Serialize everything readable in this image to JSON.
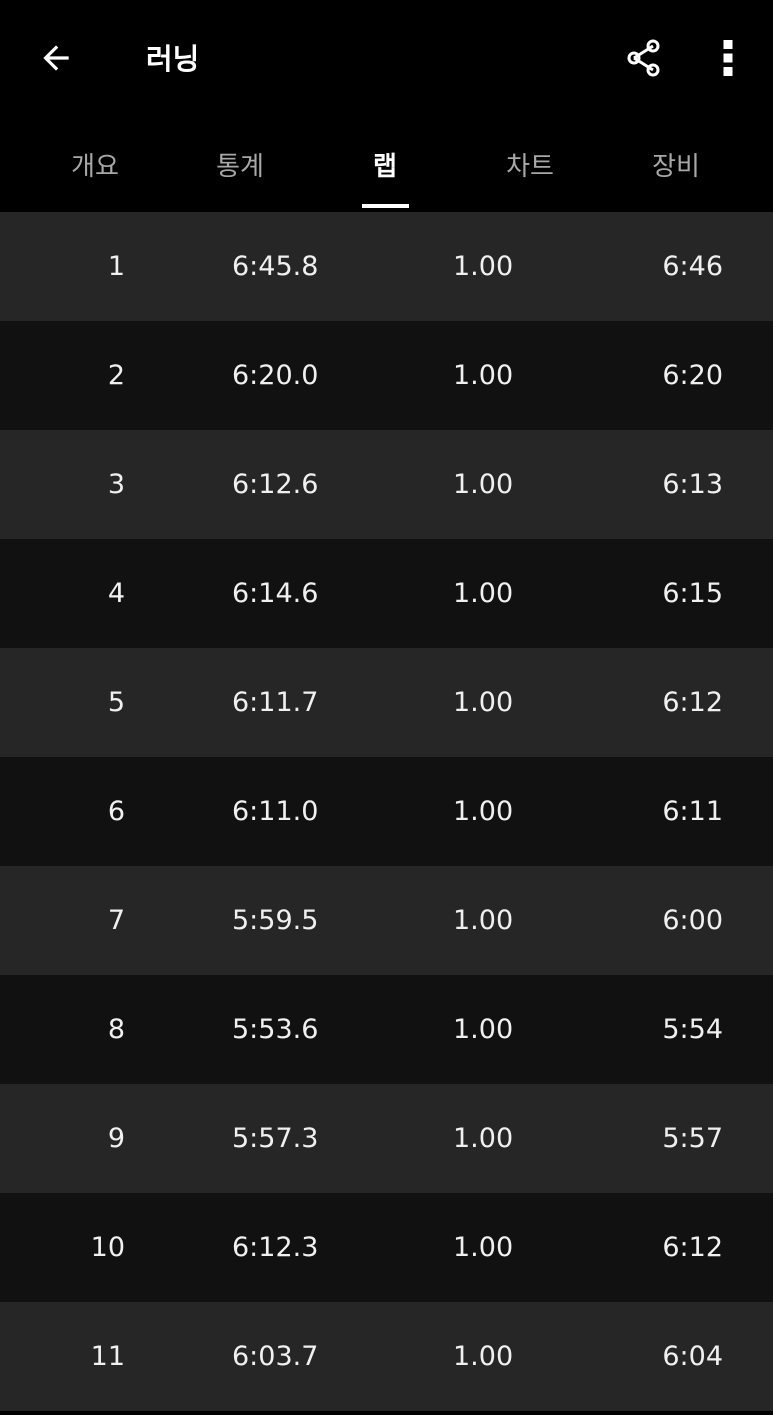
{
  "app_bar": {
    "title": "러닝",
    "icons": [
      "arrow-back-icon",
      "share-icon",
      "more-vert-icon"
    ]
  },
  "tabs": [
    {
      "label": "개요",
      "active": false
    },
    {
      "label": "통계",
      "active": false
    },
    {
      "label": "랩",
      "active": true
    },
    {
      "label": "차트",
      "active": false
    },
    {
      "label": "장비",
      "active": false
    }
  ],
  "laps": [
    {
      "lap": "1",
      "time": "6:45.8",
      "distance": "1.00",
      "pace": "6:46"
    },
    {
      "lap": "2",
      "time": "6:20.0",
      "distance": "1.00",
      "pace": "6:20"
    },
    {
      "lap": "3",
      "time": "6:12.6",
      "distance": "1.00",
      "pace": "6:13"
    },
    {
      "lap": "4",
      "time": "6:14.6",
      "distance": "1.00",
      "pace": "6:15"
    },
    {
      "lap": "5",
      "time": "6:11.7",
      "distance": "1.00",
      "pace": "6:12"
    },
    {
      "lap": "6",
      "time": "6:11.0",
      "distance": "1.00",
      "pace": "6:11"
    },
    {
      "lap": "7",
      "time": "5:59.5",
      "distance": "1.00",
      "pace": "6:00"
    },
    {
      "lap": "8",
      "time": "5:53.6",
      "distance": "1.00",
      "pace": "5:54"
    },
    {
      "lap": "9",
      "time": "5:57.3",
      "distance": "1.00",
      "pace": "5:57"
    },
    {
      "lap": "10",
      "time": "6:12.3",
      "distance": "1.00",
      "pace": "6:12"
    },
    {
      "lap": "11",
      "time": "6:03.7",
      "distance": "1.00",
      "pace": "6:04"
    }
  ],
  "colors": {
    "background": "#000000",
    "row_light": "#262626",
    "row_dark": "#111111",
    "tab_inactive": "#a8a8a8",
    "text": "#ffffff"
  }
}
